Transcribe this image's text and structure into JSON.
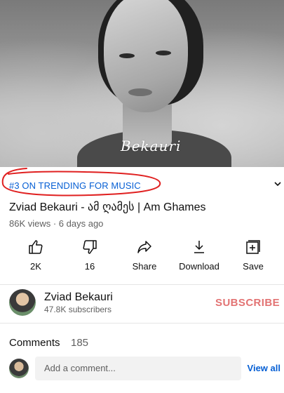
{
  "video": {
    "watermark": "Bekauri"
  },
  "details": {
    "trending": "#3 ON TRENDING FOR MUSIC",
    "title": "Zviad Bekauri - ამ ღამეს | Am Ghames",
    "meta": "86K views · 6 days ago"
  },
  "actions": [
    {
      "label": "2K",
      "icon": "thumbs-up-icon"
    },
    {
      "label": "16",
      "icon": "thumbs-down-icon"
    },
    {
      "label": "Share",
      "icon": "share-icon"
    },
    {
      "label": "Download",
      "icon": "download-icon"
    },
    {
      "label": "Save",
      "icon": "save-to-playlist-icon"
    }
  ],
  "channel": {
    "name": "Zviad Bekauri",
    "subscribers": "47.8K subscribers",
    "subscribe_label": "SUBSCRIBE"
  },
  "comments": {
    "label": "Comments",
    "count": "185",
    "placeholder": "Add a comment...",
    "view_all": "View all"
  },
  "colors": {
    "link": "#065fd4",
    "subscribe": "#cc0000",
    "annotation": "#e02020"
  }
}
